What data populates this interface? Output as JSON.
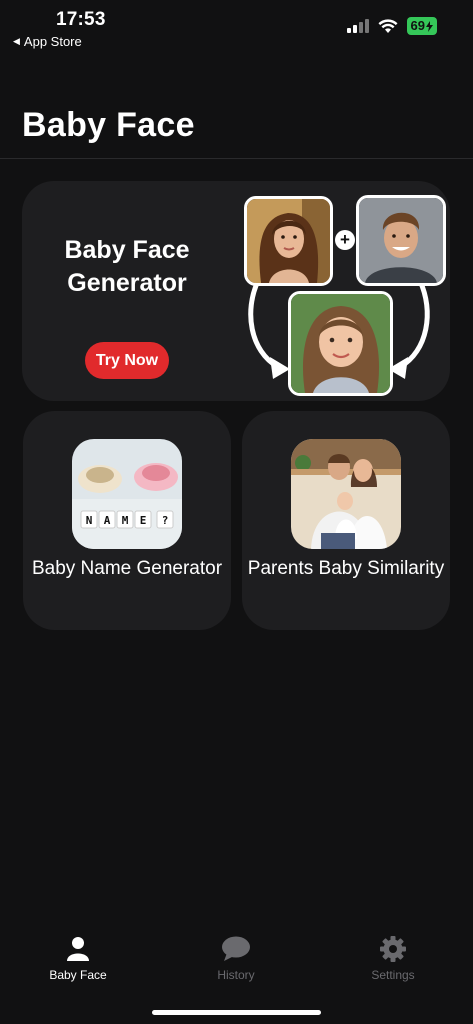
{
  "status_bar": {
    "time": "17:53",
    "back_label": "App Store",
    "battery": "69",
    "icons": [
      "cellular-signal-icon",
      "wifi-icon",
      "battery-charging-icon"
    ]
  },
  "header": {
    "title": "Baby Face"
  },
  "hero_card": {
    "title": "Baby Face Generator",
    "button_label": "Try Now",
    "button_color": "#e12a2c",
    "images": [
      "woman-portrait",
      "man-portrait",
      "child-portrait"
    ]
  },
  "feature_cards": [
    {
      "label": "Baby Name Generator",
      "image": "baby-shoes-name-blocks"
    },
    {
      "label": "Parents Baby Similarity",
      "image": "family-photo"
    }
  ],
  "name_blocks": [
    "N",
    "A",
    "M",
    "E",
    "?"
  ],
  "tab_bar": {
    "items": [
      {
        "label": "Baby Face",
        "icon": "person-icon",
        "active": true
      },
      {
        "label": "History",
        "icon": "chat-bubble-icon",
        "active": false
      },
      {
        "label": "Settings",
        "icon": "gear-icon",
        "active": false
      }
    ]
  },
  "colors": {
    "background": "#111112",
    "card": "#1e1e20",
    "accent": "#e12a2c",
    "battery": "#35c759",
    "inactive_tab": "#6a6a6e"
  }
}
